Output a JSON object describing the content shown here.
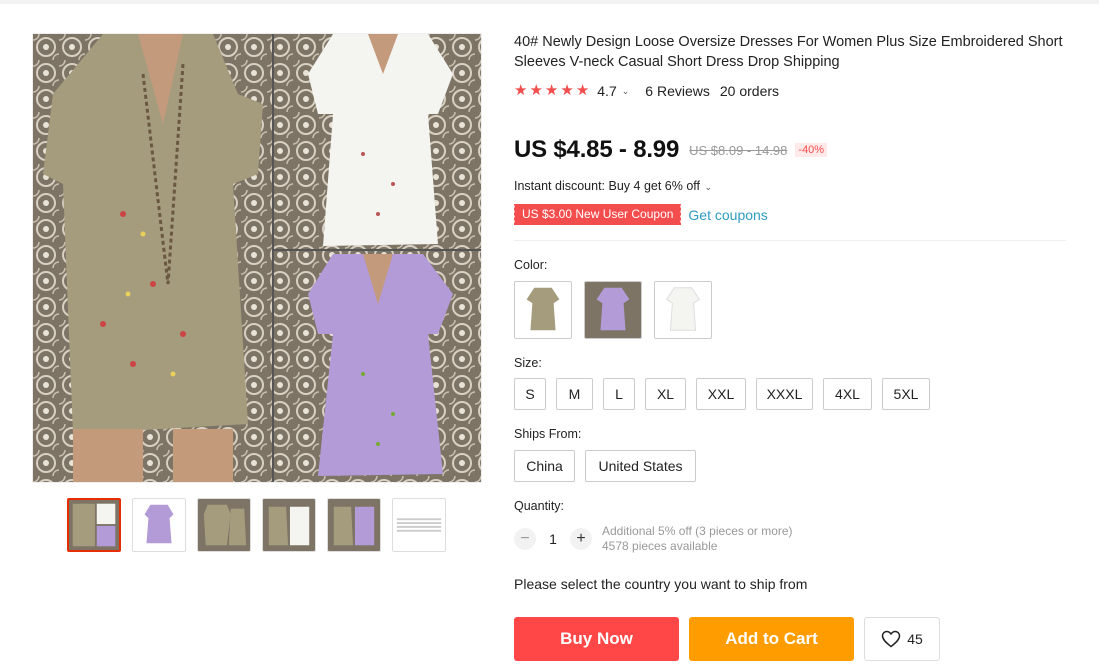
{
  "product": {
    "title": "40# Newly Design Loose Oversize Dresses For Women Plus Size Embroidered Short Sleeves V-neck Casual Short Dress Drop Shipping",
    "rating": "4.7",
    "reviews": "6 Reviews",
    "orders": "20 orders",
    "stars_filled": 5,
    "price": "US $4.85 - 8.99",
    "original_price": "US $8.09 - 14.98",
    "discount": "-40%",
    "instant_discount": "Instant discount: Buy 4 get 6% off",
    "coupon": "US $3.00 New User Coupon",
    "get_coupons": "Get coupons"
  },
  "options": {
    "color_label": "Color:",
    "colors": [
      "khaki",
      "purple",
      "white"
    ],
    "size_label": "Size:",
    "sizes": [
      "S",
      "M",
      "L",
      "XL",
      "XXL",
      "XXXL",
      "4XL",
      "5XL"
    ],
    "ships_from_label": "Ships From:",
    "ships_from": [
      "China",
      "United States"
    ],
    "quantity_label": "Quantity:",
    "quantity": "1",
    "qty_minus": "−",
    "qty_plus": "+",
    "qty_note_1": "Additional 5% off (3 pieces or more)",
    "qty_note_2": "4578 pieces available"
  },
  "shipping_note": "Please select the country you want to ship from",
  "actions": {
    "buy_now": "Buy Now",
    "add_to_cart": "Add to Cart",
    "wishlist_count": "45"
  },
  "colors": {
    "accent_red": "#ff4747",
    "accent_orange": "#ff9c00",
    "star": "#f44d4d",
    "link": "#2e9cc3",
    "khaki": "#a39a7c",
    "lilac": "#b29bd6",
    "white_dress": "#f4f4f0"
  }
}
